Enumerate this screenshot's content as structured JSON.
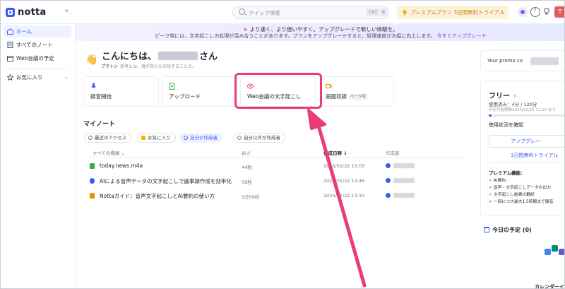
{
  "app": {
    "logo_text": "notta",
    "collapse_glyph": "«"
  },
  "topbar": {
    "search_placeholder": "クイック検索",
    "kbd_ctrl": "Ctrl",
    "kbd_k": "K",
    "premium_label": "プレミアムプラン 3日間無料トライアル",
    "avatar_letter": "T"
  },
  "sidebar": {
    "items": [
      {
        "label": "ホーム",
        "icon": "home-icon"
      },
      {
        "label": "すべてのノート",
        "icon": "note-icon"
      },
      {
        "label": "Web会議の予定",
        "icon": "calendar-icon"
      },
      {
        "label": "お気に入り",
        "icon": "star-icon"
      }
    ]
  },
  "banner": {
    "line1": "より速く、より使いやすく。アップグレードで新しい体験を。",
    "line2": "ピーク時には、文字起こしの処理が混み合うことがあります。プランをアップグレードすると、処理速度が大幅に向上します。",
    "link": "今すぐアップグレード"
  },
  "greeting": {
    "prefix": "こんにちは、",
    "suffix": "さん",
    "author": "プラトン",
    "quote": "思考とは、魂が自分と対話することだ。"
  },
  "actions": [
    {
      "label": "録音開始",
      "icon": "mic-icon",
      "color": "#3d5af1"
    },
    {
      "label": "アップロード",
      "icon": "upload-file-icon",
      "color": "#2fb344"
    },
    {
      "label": "Web会議の文字起こし",
      "icon": "meeting-icon",
      "color": "#e8416a"
    },
    {
      "label": "画面収録",
      "badge": "ベータ版",
      "icon": "screen-record-icon",
      "color": "#f08c00"
    }
  ],
  "my_notes": {
    "title": "マイノート",
    "filters": [
      "最近のアクセス",
      "お気に入り",
      "自分が作成者",
      "自分以外が作成者"
    ],
    "headers": {
      "type": "すべての種類",
      "length": "長さ",
      "created": "作成日時",
      "creator": "作成者"
    },
    "rows": [
      {
        "name": "today.news.m4a",
        "length": "44秒",
        "date": "2025/01/22 15:03",
        "icon_color": "#2fb344"
      },
      {
        "name": "AIによる音声データの文字起こしで議事録作成を効率化",
        "length": "56秒",
        "date": "2025/01/22 13:46",
        "icon_color": "#3d5af1"
      },
      {
        "name": "Nottaガイド：音声文字起こしとAI要約の使い方",
        "length": "1分50秒",
        "date": "2025/01/22 13:10",
        "icon_color": "#f08c00"
      }
    ]
  },
  "right_panel": {
    "promo": "Your promo co",
    "plan": "フリー",
    "used": "使用済み：4分 / 120分",
    "reset": "利用可能期間2025/02/22 13:10 まで",
    "usage_fraction": 0.033,
    "check_usage": "使用状況を確認",
    "upgrade": "アップグレー",
    "trial": "3日間無料トライアル",
    "features_title": "プレミアム機能：",
    "features": [
      "AI要約",
      "音声・文字起こしデータの出力",
      "文字起こし結果の翻訳",
      "一回につき最大1.5時間まで録音"
    ],
    "today": "今日の予定 (0)",
    "calendar_event": "カレンダーイベントを"
  },
  "colors": {
    "accent": "#3d5af1",
    "highlight": "#ea3d73",
    "premium_bg": "#fdf3dd"
  }
}
